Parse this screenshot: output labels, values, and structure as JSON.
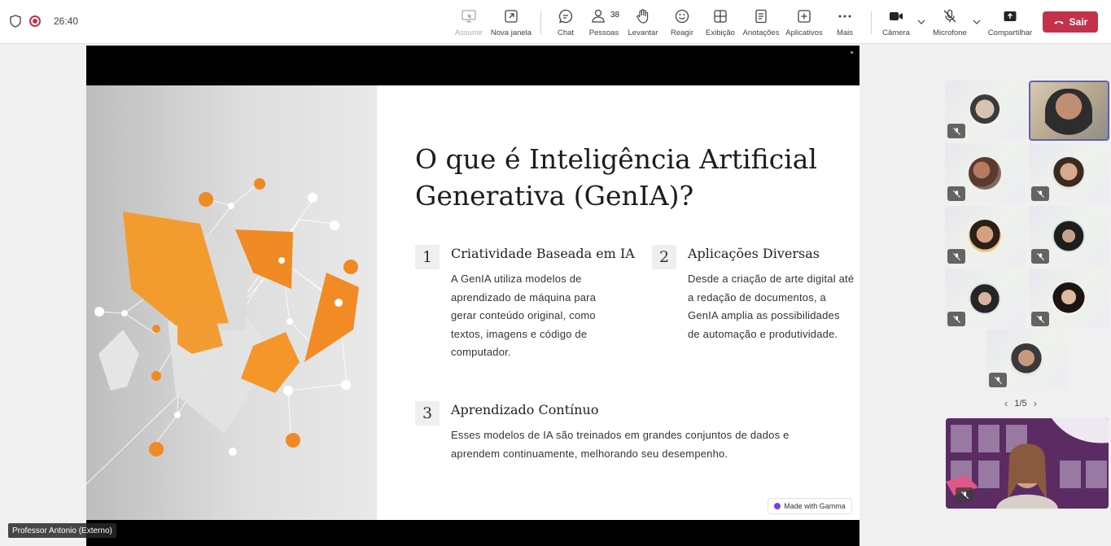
{
  "toolbar": {
    "timer": "26:40",
    "items": {
      "assumir": "Assumir",
      "nova_janela": "Nova janela",
      "chat": "Chat",
      "pessoas": "Pessoas",
      "pessoas_count": "38",
      "levantar": "Levantar",
      "reagir": "Reagir",
      "exibicao": "Exibição",
      "anotacoes": "Anotações",
      "aplicativos": "Aplicativos",
      "mais": "Mais",
      "camera": "Câmera",
      "microfone": "Microfone",
      "compartilhar": "Compartilhar"
    },
    "leave_label": "Sair",
    "leave_color": "#c4314b"
  },
  "slide": {
    "title_line1": "O que é Inteligência Artificial",
    "title_line2": "Generativa (GenIA)?",
    "items": [
      {
        "number": "1",
        "heading": "Criatividade Baseada em IA",
        "text": "A GenIA utiliza modelos de aprendizado de máquina para gerar conteúdo original, como textos, imagens e código de computador."
      },
      {
        "number": "2",
        "heading": "Aplicações Diversas",
        "text": "Desde a criação de arte digital até a redação de documentos, a GenIA amplia as possibilidades de automação e produtividade."
      },
      {
        "number": "3",
        "heading": "Aprendizado Contínuo",
        "text": "Esses modelos de IA são treinados em grandes conjuntos de dados e aprendem continuamente, melhorando seu desempenho."
      }
    ],
    "badge": "Made with Gamma",
    "accent": "#f08a24"
  },
  "presenter_name": "Professor Antonio (Externo)",
  "gallery": {
    "pager": "1/5",
    "active_border": "#5b5fc7"
  }
}
